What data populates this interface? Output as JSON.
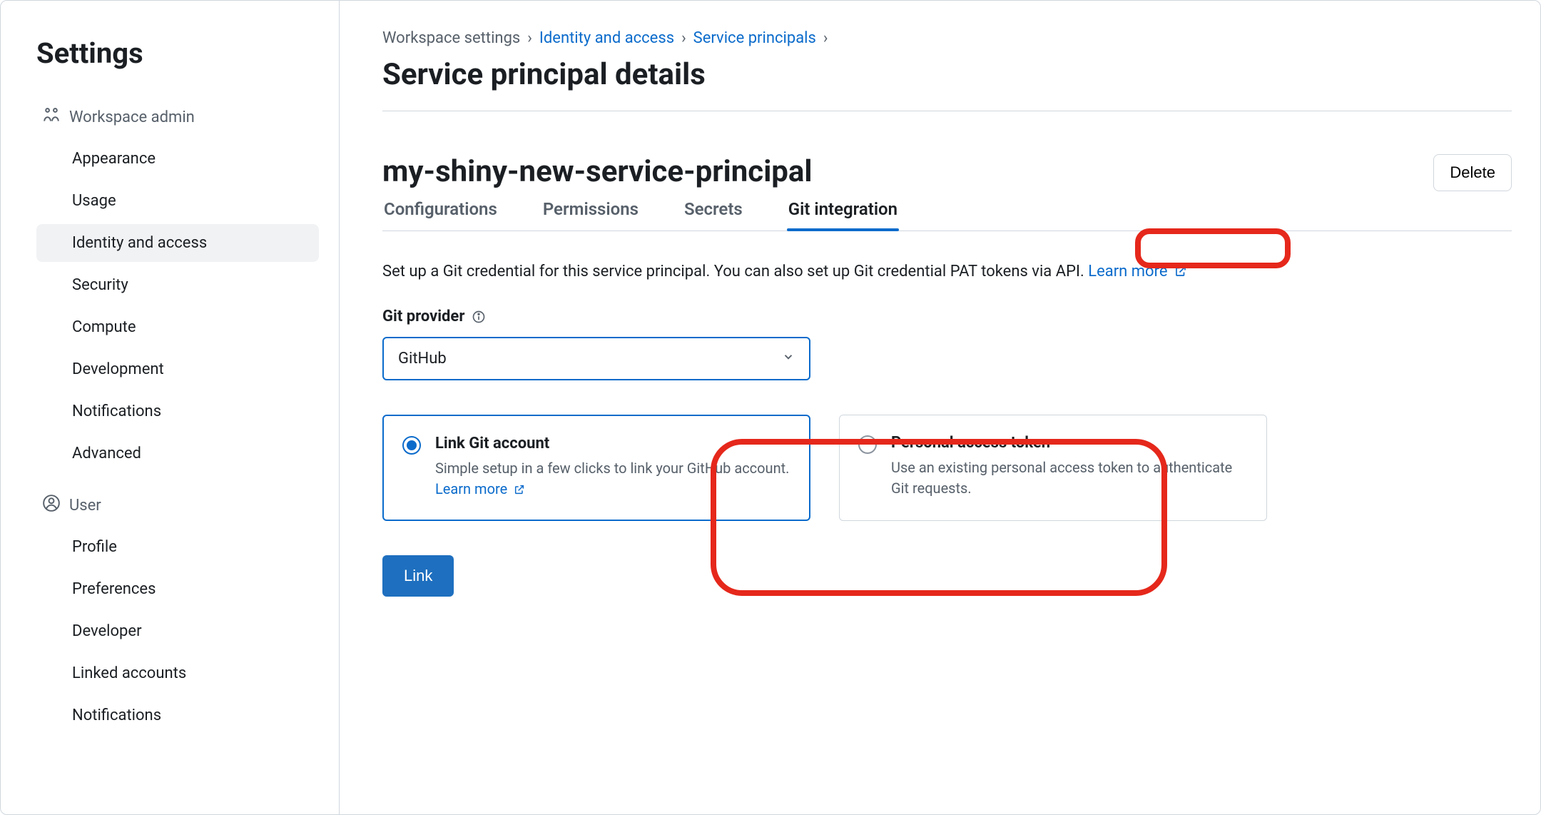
{
  "sidebar": {
    "title": "Settings",
    "sections": [
      {
        "header": "Workspace admin",
        "items": [
          {
            "label": "Appearance"
          },
          {
            "label": "Usage"
          },
          {
            "label": "Identity and access",
            "active": true
          },
          {
            "label": "Security"
          },
          {
            "label": "Compute"
          },
          {
            "label": "Development"
          },
          {
            "label": "Notifications"
          },
          {
            "label": "Advanced"
          }
        ]
      },
      {
        "header": "User",
        "items": [
          {
            "label": "Profile"
          },
          {
            "label": "Preferences"
          },
          {
            "label": "Developer"
          },
          {
            "label": "Linked accounts"
          },
          {
            "label": "Notifications"
          }
        ]
      }
    ]
  },
  "breadcrumb": {
    "items": [
      {
        "label": "Workspace settings",
        "link": false
      },
      {
        "label": "Identity and access",
        "link": true
      },
      {
        "label": "Service principals",
        "link": true
      }
    ]
  },
  "page": {
    "title": "Service principal details",
    "entity_name": "my-shiny-new-service-principal",
    "delete_label": "Delete"
  },
  "tabs": [
    {
      "label": "Configurations"
    },
    {
      "label": "Permissions"
    },
    {
      "label": "Secrets"
    },
    {
      "label": "Git integration",
      "active": true
    }
  ],
  "git": {
    "description": "Set up a Git credential for this service principal. You can also set up Git credential PAT tokens via API. ",
    "learn_more": "Learn more",
    "provider_label": "Git provider",
    "provider_value": "GitHub",
    "options": [
      {
        "title": "Link Git account",
        "desc_prefix": "Simple setup in a few clicks to link your GitHub account. ",
        "learn_more": "Learn more",
        "selected": true
      },
      {
        "title": "Personal access token",
        "desc_prefix": "Use an existing personal access token to authenticate Git requests.",
        "learn_more": "",
        "selected": false
      }
    ],
    "link_button": "Link"
  }
}
